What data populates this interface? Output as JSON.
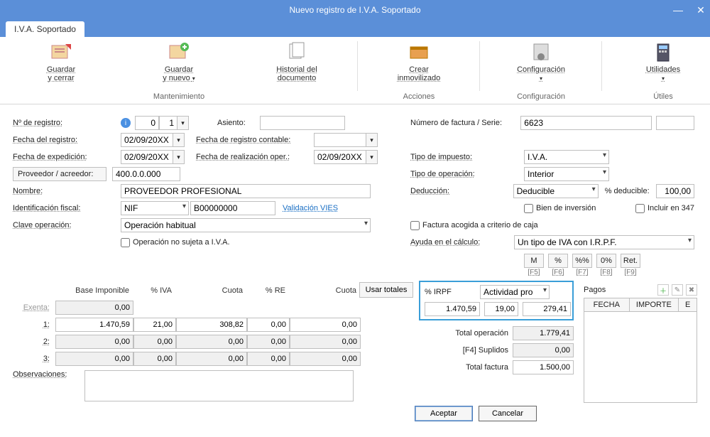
{
  "window": {
    "title": "Nuevo registro de I.V.A. Soportado"
  },
  "tab": {
    "label": "I.V.A. Soportado"
  },
  "ribbon": {
    "guardar_cerrar": "Guardar\ny cerrar",
    "guardar_nuevo": "Guardar\ny nuevo",
    "historial": "Historial del\ndocumento",
    "crear_inmov": "Crear\ninmovilizado",
    "config": "Configuración",
    "utilidades": "Utilidades",
    "grp_mantenimiento": "Mantenimiento",
    "grp_acciones": "Acciones",
    "grp_configuracion": "Configuración",
    "grp_utiles": "Útiles"
  },
  "labels": {
    "n_registro": "Nº de registro:",
    "fecha_registro": "Fecha del registro:",
    "fecha_expedicion": "Fecha de expedición:",
    "proveedor": "Proveedor / acreedor:",
    "nombre": "Nombre:",
    "id_fiscal": "Identificación fiscal:",
    "clave_op": "Clave operación:",
    "op_no_sujeta": "Operación no sujeta a I.V.A.",
    "asiento": "Asiento:",
    "fecha_reg_contable": "Fecha de registro contable:",
    "fecha_real_oper": "Fecha de realización oper.:",
    "num_factura": "Número de factura / Serie:",
    "tipo_impuesto": "Tipo de impuesto:",
    "tipo_operacion": "Tipo de operación:",
    "deduccion": "Deducción:",
    "pct_deducible": "% deducible:",
    "bien_inversion": "Bien de inversión",
    "incluir_347": "Incluir en 347",
    "factura_criterio_caja": "Factura acogida a criterio de caja",
    "ayuda_calculo": "Ayuda en el cálculo:",
    "validacion_vies": "Validación VIES",
    "base_imponible": "Base Imponible",
    "pct_iva": "% IVA",
    "cuota": "Cuota",
    "pct_re": "% RE",
    "usar_totales": "Usar totales",
    "pct_irpf": "% IRPF",
    "actividad_pro": "Actividad pro",
    "pagos": "Pagos",
    "total_operacion": "Total operación",
    "f4_suplidos": "[F4] Suplidos",
    "total_factura": "Total factura",
    "observaciones": "Observaciones:",
    "aceptar": "Aceptar",
    "cancelar": "Cancelar",
    "exenta": "Exenta:",
    "r1": "1:",
    "r2": "2:",
    "r3": "3:",
    "m": "M",
    "pct": "%",
    "pctpct": "%%",
    "zeropct": "0%",
    "ret": "Ret.",
    "f5": "[F5]",
    "f6": "[F6]",
    "f7": "[F7]",
    "f8": "[F8]",
    "f9": "[F9]",
    "fecha": "FECHA",
    "importe": "IMPORTE",
    "e": "E"
  },
  "values": {
    "n_registro_a": "0",
    "n_registro_b": "1",
    "fecha_registro": "02/09/20XX",
    "fecha_expedicion": "02/09/20XX",
    "proveedor": "400.0.0.000",
    "nombre": "PROVEEDOR PROFESIONAL",
    "id_fiscal_tipo": "NIF",
    "id_fiscal_num": "B00000000",
    "clave_op": "Operación habitual",
    "asiento": "",
    "fecha_reg_contable": "",
    "fecha_real_oper": "02/09/20XX",
    "num_factura": "6623",
    "serie": "",
    "tipo_impuesto": "I.V.A.",
    "tipo_operacion": "Interior",
    "deduccion": "Deducible",
    "pct_deducible": "100,00",
    "ayuda_calculo": "Un tipo de IVA con I.R.P.F.",
    "exenta": "0,00",
    "base1": "1.470,59",
    "iva1": "21,00",
    "cuota1": "308,82",
    "re1": "0,00",
    "cuotare1": "0,00",
    "base2": "0,00",
    "iva2": "0,00",
    "cuota2": "0,00",
    "re2": "0,00",
    "cuotare2": "0,00",
    "base3": "0,00",
    "iva3": "0,00",
    "cuota3": "0,00",
    "re3": "0,00",
    "cuotare3": "0,00",
    "irpf_base": "1.470,59",
    "irpf_pct": "19,00",
    "irpf_cuota": "279,41",
    "total_operacion": "1.779,41",
    "suplidos": "0,00",
    "total_factura": "1.500,00"
  }
}
